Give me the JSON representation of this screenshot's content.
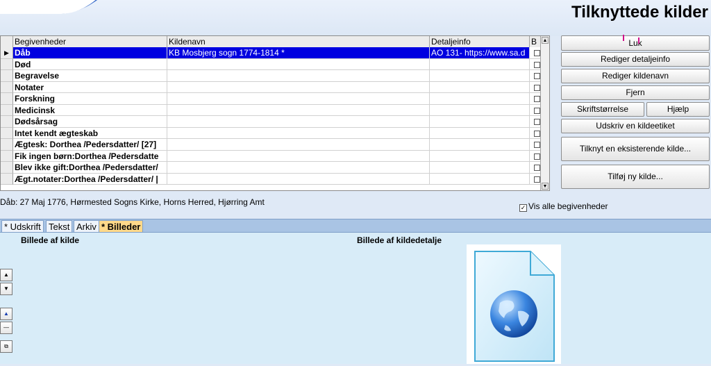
{
  "window": {
    "title": "Tilknyttede kilder"
  },
  "grid": {
    "columns": [
      "Begivenheder",
      "Kildenavn",
      "Detaljeinfo",
      "B"
    ],
    "rows": [
      {
        "event": "Dåb",
        "source": "KB Mosbjerg sogn 1774-1814 *",
        "detail": "AO 131- https://www.sa.d",
        "selected": true,
        "marker": "▶"
      },
      {
        "event": "Død",
        "source": "",
        "detail": "",
        "selected": false,
        "marker": ""
      },
      {
        "event": "Begravelse",
        "source": "",
        "detail": "",
        "selected": false,
        "marker": ""
      },
      {
        "event": "Notater",
        "source": "",
        "detail": "",
        "selected": false,
        "marker": ""
      },
      {
        "event": "Forskning",
        "source": "",
        "detail": "",
        "selected": false,
        "marker": ""
      },
      {
        "event": "Medicinsk",
        "source": "",
        "detail": "",
        "selected": false,
        "marker": ""
      },
      {
        "event": "Dødsårsag",
        "source": "",
        "detail": "",
        "selected": false,
        "marker": ""
      },
      {
        "event": "Intet kendt ægteskab",
        "source": "",
        "detail": "",
        "selected": false,
        "marker": ""
      },
      {
        "event": "Ægtesk: Dorthea /Pedersdatter/ [27]",
        "source": "",
        "detail": "",
        "selected": false,
        "marker": ""
      },
      {
        "event": "Fik ingen børn:Dorthea /Pedersdatte",
        "source": "",
        "detail": "",
        "selected": false,
        "marker": ""
      },
      {
        "event": "Blev ikke gift:Dorthea /Pedersdatter/",
        "source": "",
        "detail": "",
        "selected": false,
        "marker": ""
      },
      {
        "event": "Ægt.notater:Dorthea /Pedersdatter/ |",
        "source": "",
        "detail": "",
        "selected": false,
        "marker": ""
      }
    ]
  },
  "buttons": {
    "luk": "Luk",
    "rediger_detaljeinfo": "Rediger detaljeinfo",
    "rediger_kildenavn": "Rediger kildenavn",
    "fjern": "Fjern",
    "skriftstorrelse": "Skriftstørrelse",
    "hjaelp": "Hjælp",
    "udskriv_kildeetiket": "Udskriv en kildeetiket",
    "tilknyt_eksisterende": "Tilknyt en eksisterende kilde...",
    "tilfoej_ny": "Tilføj ny kilde..."
  },
  "status": {
    "text": "Dåb: 27 Maj 1776, Hørmested Sogns Kirke, Horns Herred, Hjørring Amt"
  },
  "vis_alle": {
    "label": "Vis alle begivenheder",
    "checked": true,
    "check_glyph": "✓"
  },
  "tabs": [
    {
      "label": "* Udskrift",
      "active": false
    },
    {
      "label": "Tekst",
      "active": false
    },
    {
      "label": "Arkiv",
      "active": false
    },
    {
      "label": "* Billeder",
      "active": true
    }
  ],
  "images": {
    "source_label": "Billede af kilde",
    "detail_label": "Billede af kildedetalje",
    "file_icon": "globe-document-icon"
  },
  "side_buttons": [
    "▲",
    "▼",
    "▲",
    "—",
    "⧉"
  ]
}
